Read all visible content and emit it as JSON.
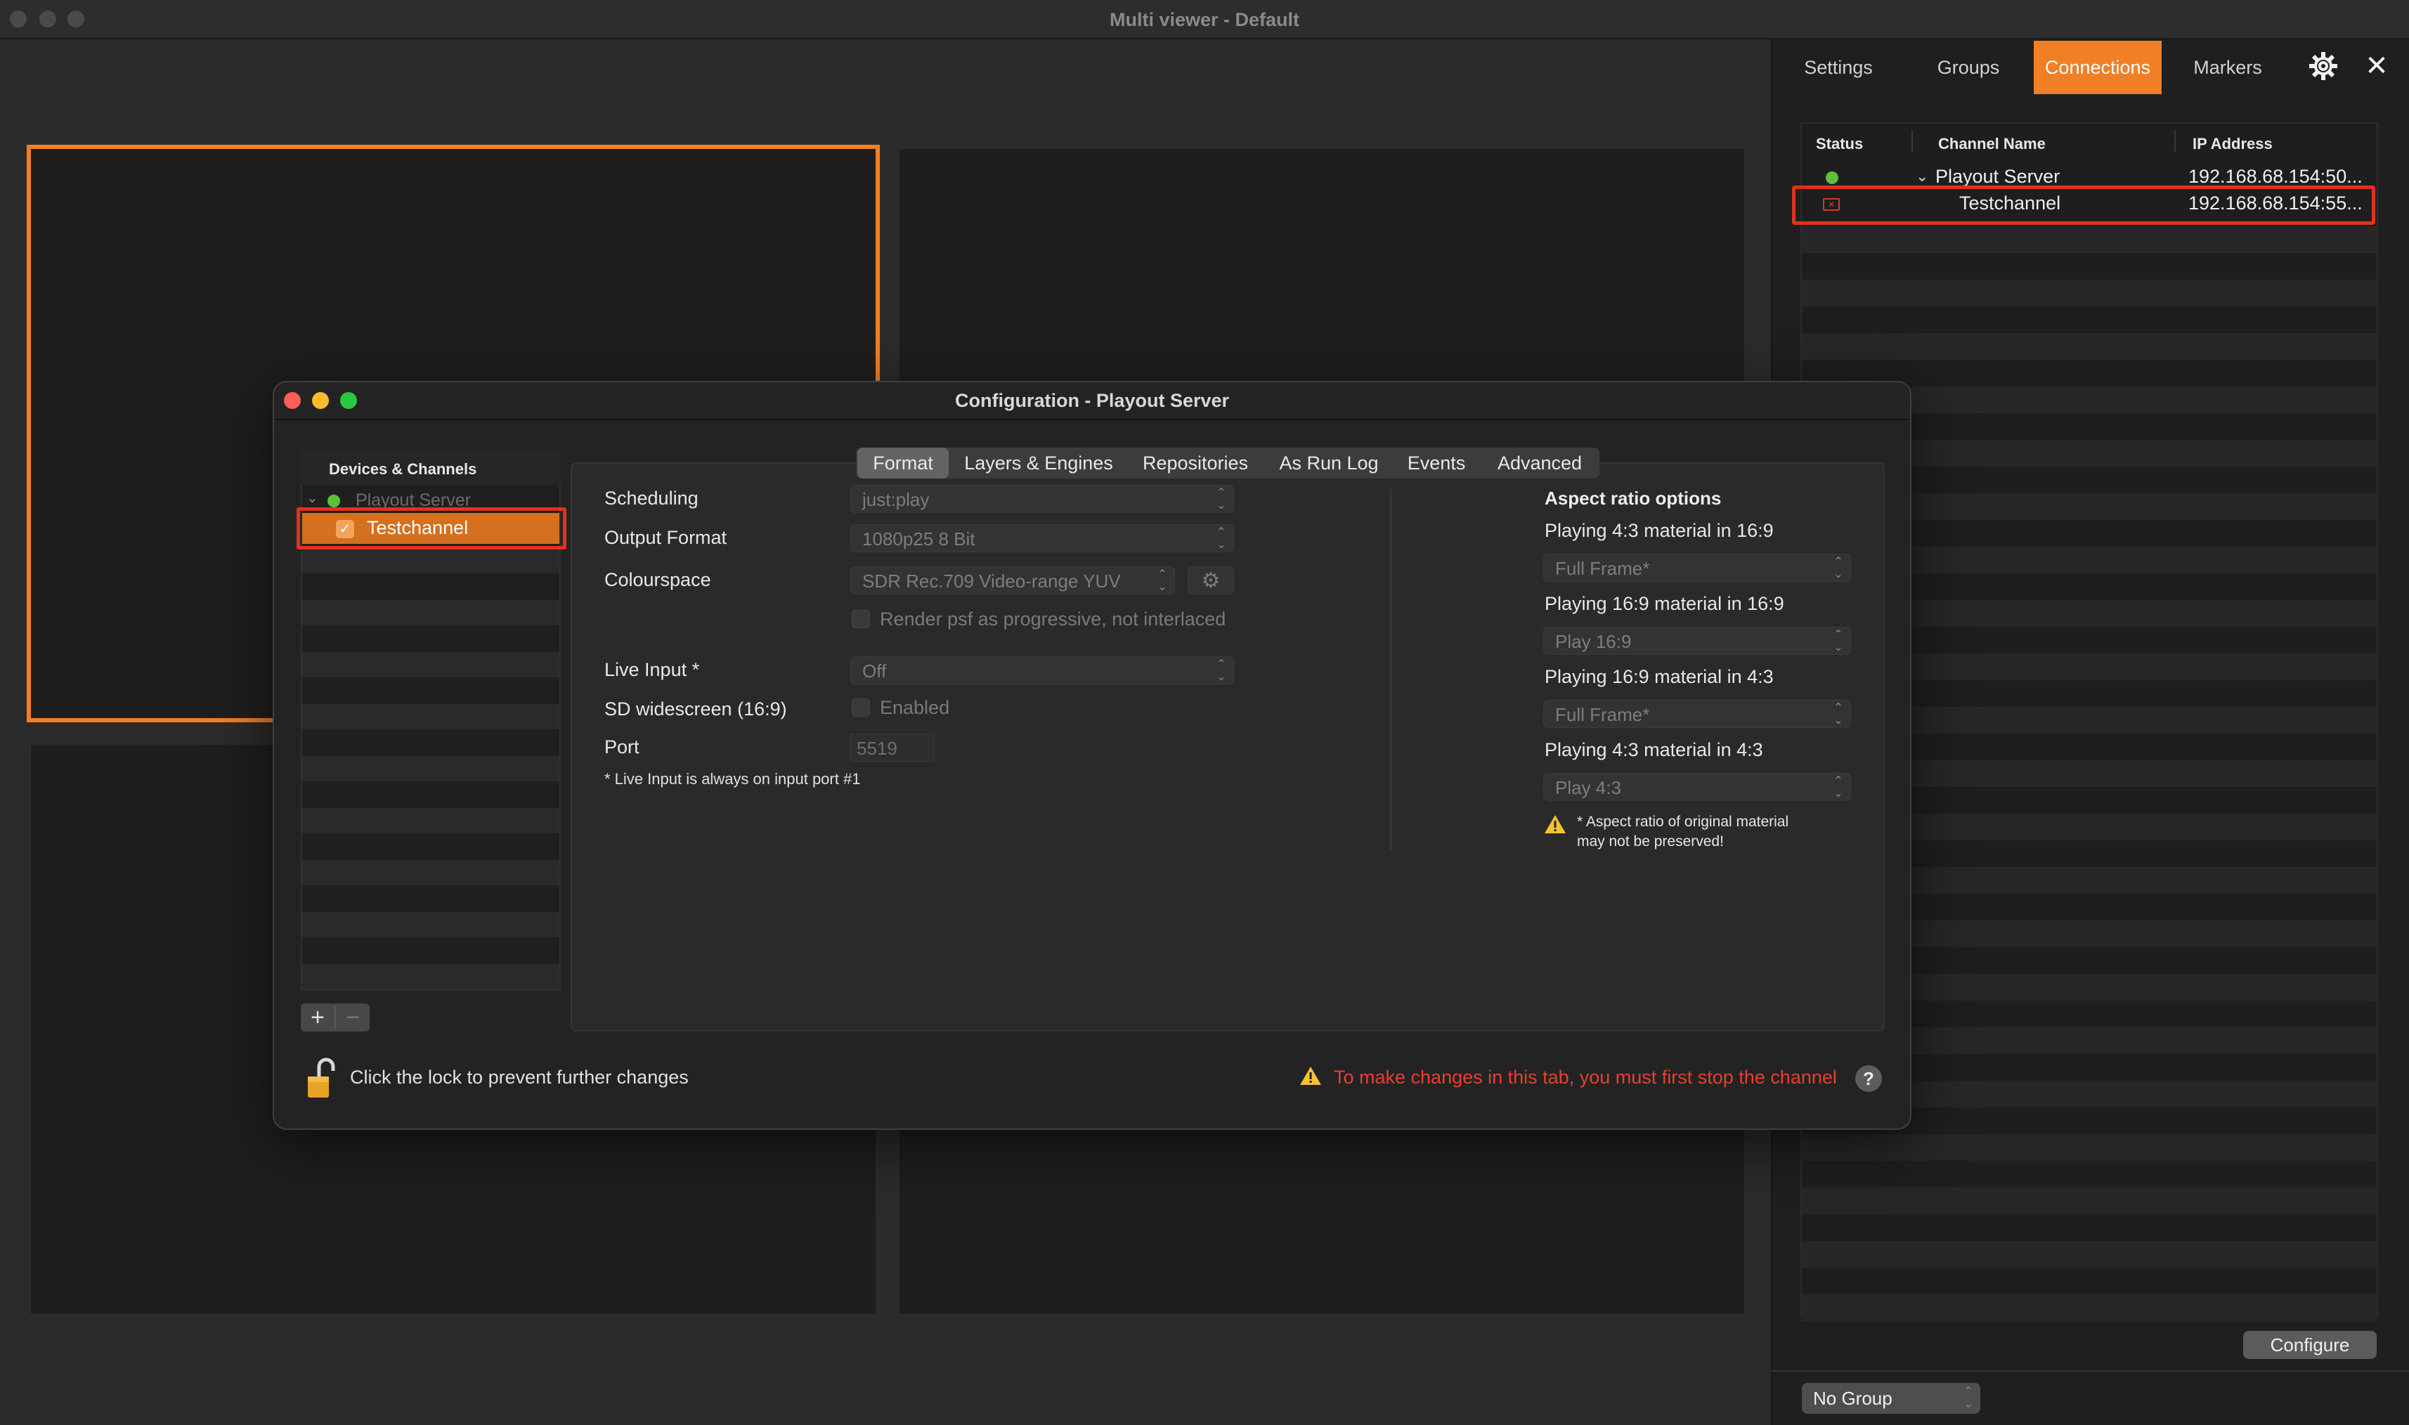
{
  "main_window": {
    "title": "Multi viewer - Default"
  },
  "right_panel": {
    "tabs": [
      {
        "label": "Settings"
      },
      {
        "label": "Groups"
      },
      {
        "label": "Connections"
      },
      {
        "label": "Markers"
      }
    ],
    "active_tab": "Connections",
    "table": {
      "columns": [
        "Status",
        "Channel Name",
        "IP Address"
      ],
      "rows": [
        {
          "status": "connected",
          "name": "Playout Server",
          "ip": "192.168.68.154:50..."
        },
        {
          "status": "error",
          "name": "Testchannel",
          "ip": "192.168.68.154:55..."
        }
      ]
    },
    "configure_label": "Configure",
    "group_select": "No Group"
  },
  "dialog": {
    "title": "Configuration - Playout Server",
    "devices": {
      "header": "Devices & Channels",
      "server": "Playout Server",
      "channel": "Testchannel"
    },
    "tabs": [
      {
        "label": "Format"
      },
      {
        "label": "Layers & Engines"
      },
      {
        "label": "Repositories"
      },
      {
        "label": "As Run Log"
      },
      {
        "label": "Events"
      },
      {
        "label": "Advanced"
      }
    ],
    "active_tab": "Format",
    "format": {
      "scheduling_label": "Scheduling",
      "scheduling_value": "just:play",
      "output_format_label": "Output Format",
      "output_format_value": "1080p25 8 Bit",
      "colourspace_label": "Colourspace",
      "colourspace_value": "SDR Rec.709 Video-range YUV",
      "render_psf_label": "Render psf as progressive, not interlaced",
      "live_input_label": "Live Input *",
      "live_input_value": "Off",
      "sd_widescreen_label": "SD widescreen (16:9)",
      "sd_widescreen_value": "Enabled",
      "port_label": "Port",
      "port_value": "5519",
      "live_input_note": "* Live Input is always on input port #1"
    },
    "aspect": {
      "title": "Aspect ratio options",
      "items": [
        {
          "label": "Playing 4:3 material in 16:9",
          "value": "Full Frame*"
        },
        {
          "label": "Playing 16:9 material in 16:9",
          "value": "Play 16:9"
        },
        {
          "label": "Playing 16:9 material in 4:3",
          "value": "Full Frame*"
        },
        {
          "label": "Playing 4:3 material in 4:3",
          "value": "Play 4:3"
        }
      ],
      "warning_line1": "* Aspect ratio of original material",
      "warning_line2": "may not be preserved!"
    },
    "footer": {
      "lock_text": "Click the lock to prevent further changes",
      "warning_text": "To make changes in this tab, you must first stop the channel",
      "help": "?"
    }
  },
  "colors": {
    "accent": "#f07f26",
    "highlight": "#e0321f",
    "status_ok": "#5fbf3a",
    "warning": "#e5402d"
  }
}
